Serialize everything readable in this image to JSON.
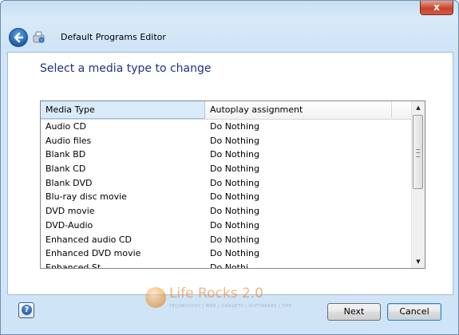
{
  "window": {
    "title": "Default Programs Editor",
    "close_label": "x"
  },
  "main": {
    "heading": "Select a media type to change"
  },
  "table": {
    "columns": [
      "Media Type",
      "Autoplay assignment"
    ],
    "rows": [
      {
        "type": "Audio CD",
        "assignment": "Do Nothing"
      },
      {
        "type": "Audio files",
        "assignment": "Do Nothing"
      },
      {
        "type": "Blank BD",
        "assignment": "Do Nothing"
      },
      {
        "type": "Blank CD",
        "assignment": "Do Nothing"
      },
      {
        "type": "Blank DVD",
        "assignment": "Do Nothing"
      },
      {
        "type": "Blu-ray disc movie",
        "assignment": "Do Nothing"
      },
      {
        "type": "DVD movie",
        "assignment": "Do Nothing"
      },
      {
        "type": "DVD-Audio",
        "assignment": "Do Nothing"
      },
      {
        "type": "Enhanced audio CD",
        "assignment": "Do Nothing"
      },
      {
        "type": "Enhanced DVD movie",
        "assignment": "Do Nothing"
      },
      {
        "type": "Enhanced St...",
        "assignment": "Do Nothi..."
      }
    ]
  },
  "watermark": {
    "title": "Life Rocks 2.0",
    "subtitle": "TECHNOLOGY | WEB | GADGETS | SOFTWARES | TIPS"
  },
  "footer": {
    "help_label": "?",
    "next_label": "Next",
    "cancel_label": "Cancel"
  },
  "icons": {
    "back": "back-arrow-icon",
    "app": "default-programs-icon",
    "help": "help-icon"
  },
  "colors": {
    "heading": "#1e3287",
    "header_selected": "#d9ebf9",
    "close_button": "#c8432c"
  }
}
